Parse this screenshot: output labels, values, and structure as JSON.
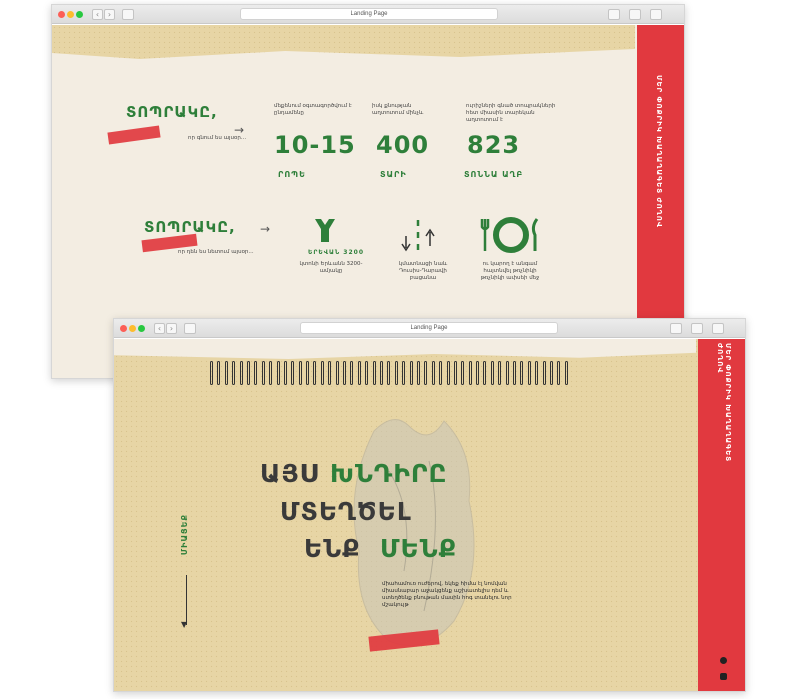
{
  "window1": {
    "title": "Landing Page",
    "side_band": "ՄԵՐ ՓՈՔՐԻԿ ԽԱՂԱՂԱԳԵՏ ԺՈՂՈՎ",
    "row1": {
      "headline": "ՏՈՊՐԱԿԸ,",
      "sub": "որ գնում ես այսօր...",
      "stats": [
        {
          "caption": "մեքենում օգտագործվում է ընդամենը",
          "value": "10-15",
          "unit": "ՐՈՊԵ"
        },
        {
          "caption": "իսկ քնության աղտոտում մինչև",
          "value": "400",
          "unit": "ՏԱՐԻ"
        },
        {
          "caption": "ուրիշների գնած տոպրակների հետ միասին տարեկան աղտոտում է",
          "value": "823",
          "unit": "ՏՈՆՆԱ ԱՂԲ"
        }
      ]
    },
    "row2": {
      "headline": "ՏՈՊՐԱԿԸ,",
      "sub": "որ դեն ես նետում այսօր...",
      "items": [
        {
          "badge": "ԵՐԵՎԱՆ 3200",
          "caption": "կտոնի Երևանն 3200-ամյակը"
        },
        {
          "caption": "կմատնացի նաև Դուսիս-Դարավի բացանա"
        },
        {
          "caption": "ու կարող է անգամ հայտնվել թռչնիկի թռչնիկի ափսեի մեջ"
        }
      ]
    }
  },
  "window2": {
    "title": "Landing Page",
    "side_band": "ՄԵՐ ՓՈՔՐԻԿ ԽԱՂԱՂԱԳԵՏ ԺՈՂՈՎ",
    "left_label": "ՄԻԱՑԵՔ",
    "headline": {
      "line1_dark": "ԱՅՍ",
      "line1_green": "ԽՆԴԻՐԸ",
      "line2": "ՄՏԵՂԾԵԼ",
      "line3_dark": "ԵՆՔ",
      "line3_green": "ՄԵՆՔ"
    },
    "paragraph": "միահամուռ ուժերով, եկեք հիմա էլ նոմվան միասնաբար աջակցենք աշխատելիս դեմ և ստեղծենք բնութան մասին հոգ տանելու նոր մշակույթ"
  },
  "colors": {
    "red": "#e1393f",
    "green": "#2e7f3a",
    "kraft": "#e7d5a5"
  }
}
